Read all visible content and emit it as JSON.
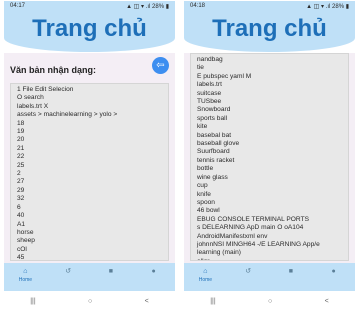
{
  "left": {
    "status": {
      "time": "04:17",
      "indicators": "▲ ◫ ▾ .ıl 28% ▮"
    },
    "app_title": "Trang chủ",
    "result_title": "Văn bản nhận dạng:",
    "fab_icon": "arrow-left-icon",
    "lines": [
      "1 File Edit Selecion",
      "O search",
      "labels.trt X",
      "assets > machinelearning > yolo >",
      "18",
      "19",
      "20",
      "21",
      "22",
      "25",
      "2",
      "27",
      "29",
      "32",
      "6",
      "40",
      "A1",
      "horse",
      "sheep",
      "cOl",
      "45"
    ],
    "nav": [
      {
        "label": "Home",
        "icon": "home-icon"
      },
      {
        "label": "",
        "icon": "history-icon"
      },
      {
        "label": "",
        "icon": "bookmark-icon"
      },
      {
        "label": "",
        "icon": "person-icon"
      }
    ],
    "system_nav": [
      "|||",
      "○",
      "<"
    ]
  },
  "right": {
    "status": {
      "time": "04:18",
      "indicators": "▲ ◫ ▾ .ıl 28% ▮"
    },
    "app_title": "Trang chủ",
    "fab_icon": "arrow-left-icon",
    "lines": [
      "nandbag",
      "tie",
      "E pubspec yaml M",
      "labels.trt",
      "suitcase",
      "TUSbee",
      "Snowboard",
      "sports ball",
      "kite",
      "basebal bat",
      "baseball glove",
      "Suurfboard",
      "tennis racket",
      "bottle",
      "wine glass",
      "cup",
      "knife",
      "spoon",
      "46 bowl",
      "EBUG CONSOLE TERMINAL PORTS",
      "s DELEARNING ApD main O oA104",
      "AndroidManifestxml env",
      "johnnNSI MINGH64 -/E LEARNING App/e",
      "learning (main)",
      "allgr"
    ],
    "nav": [
      {
        "label": "Home",
        "icon": "home-icon"
      },
      {
        "label": "",
        "icon": "history-icon"
      },
      {
        "label": "",
        "icon": "bookmark-icon"
      },
      {
        "label": "",
        "icon": "person-icon"
      }
    ],
    "system_nav": [
      "|||",
      "○",
      "<"
    ]
  }
}
